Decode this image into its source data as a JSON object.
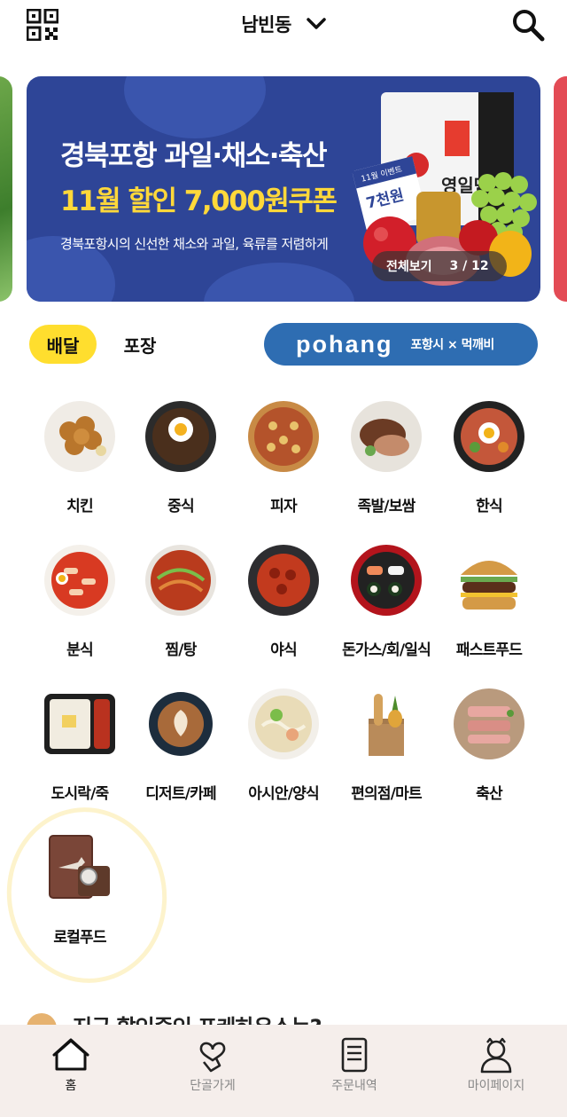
{
  "header": {
    "location": "남빈동"
  },
  "banner": {
    "title_line1": "경북포항 과일·채소·축산",
    "title_line2": "11월 할인 7,000원쿠폰",
    "subtitle": "경북포항시의 신선한 채소와 과일, 육류를 저렴하게",
    "view_all": "전체보기",
    "page_current": "3",
    "page_total": "12",
    "page_indicator": "3 / 12",
    "tag_event": "11월 이벤트",
    "tag_amount": "7천원",
    "bag_text": "영일만친구"
  },
  "tabs": {
    "delivery": "배달",
    "pickup": "포장"
  },
  "promo": {
    "logo": "pohang",
    "text": "포항시 × 먹깨비"
  },
  "categories": [
    {
      "label": "치킨"
    },
    {
      "label": "중식"
    },
    {
      "label": "피자"
    },
    {
      "label": "족발/보쌈"
    },
    {
      "label": "한식"
    },
    {
      "label": "분식"
    },
    {
      "label": "찜/탕"
    },
    {
      "label": "야식"
    },
    {
      "label": "돈가스/회/일식"
    },
    {
      "label": "패스트푸드"
    },
    {
      "label": "도시락/죽"
    },
    {
      "label": "디저트/카페"
    },
    {
      "label": "아시안/양식"
    },
    {
      "label": "편의점/마트"
    },
    {
      "label": "축산"
    },
    {
      "label": "로컬푸드"
    }
  ],
  "next_section": {
    "title": "지금 할인중인 포케하우스는?"
  },
  "bottom_nav": [
    {
      "label": "홈"
    },
    {
      "label": "단골가게"
    },
    {
      "label": "주문내역"
    },
    {
      "label": "마이페이지"
    }
  ],
  "colors": {
    "accent_yellow": "#ffde2e",
    "banner_blue": "#2e4597",
    "promo_blue": "#2e6db2",
    "nav_bg": "#f5eeeb"
  }
}
